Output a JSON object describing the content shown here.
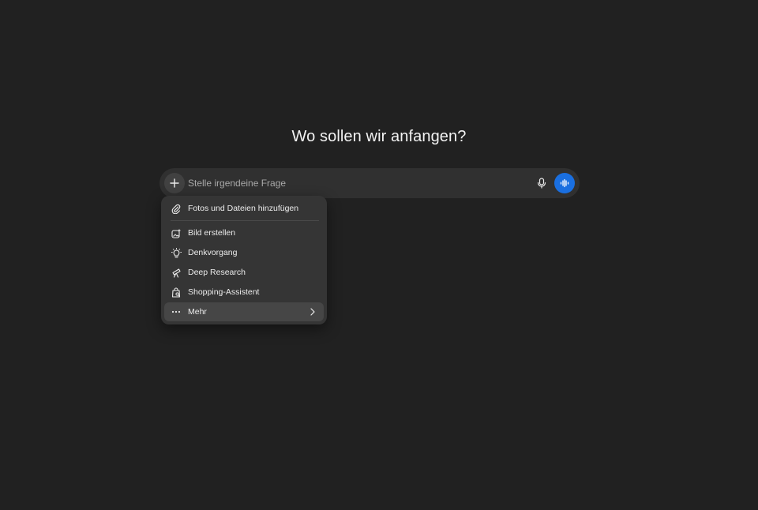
{
  "headline": "Wo sollen wir anfangen?",
  "composer": {
    "placeholder": "Stelle irgendeine Frage",
    "value": "",
    "accent_color": "#1a6fe0"
  },
  "menu": {
    "items": [
      {
        "label": "Fotos und Dateien hinzufügen",
        "icon": "paperclip-icon"
      },
      {
        "label": "Bild erstellen",
        "icon": "image-sparkle-icon"
      },
      {
        "label": "Denkvorgang",
        "icon": "lightbulb-icon"
      },
      {
        "label": "Deep Research",
        "icon": "telescope-icon"
      },
      {
        "label": "Shopping-Assistent",
        "icon": "shopping-bag-icon"
      },
      {
        "label": "Mehr",
        "icon": "more-dots-icon"
      }
    ]
  }
}
